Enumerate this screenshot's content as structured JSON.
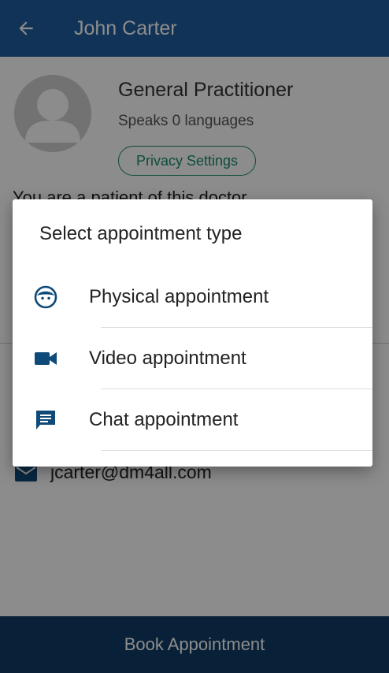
{
  "appbar": {
    "title": "John Carter",
    "back_icon": "arrow-left-icon"
  },
  "doctor": {
    "specialty": "General Practitioner",
    "languages": "Speaks 0 languages",
    "privacy_button": "Privacy Settings",
    "patient_status": "You are a patient of this doctor",
    "email": "jcarter@dm4all.com"
  },
  "dialog": {
    "title": "Select appointment type",
    "options": [
      {
        "label": "Physical appointment",
        "icon": "face-icon"
      },
      {
        "label": "Video appointment",
        "icon": "videocam-icon"
      },
      {
        "label": "Chat appointment",
        "icon": "chat-icon"
      }
    ]
  },
  "footer": {
    "book_label": "Book Appointment"
  },
  "colors": {
    "primary": "#1f5e9f",
    "footer": "#0f3d67",
    "accent": "#1a8a6e",
    "icon": "#0f4a78"
  }
}
